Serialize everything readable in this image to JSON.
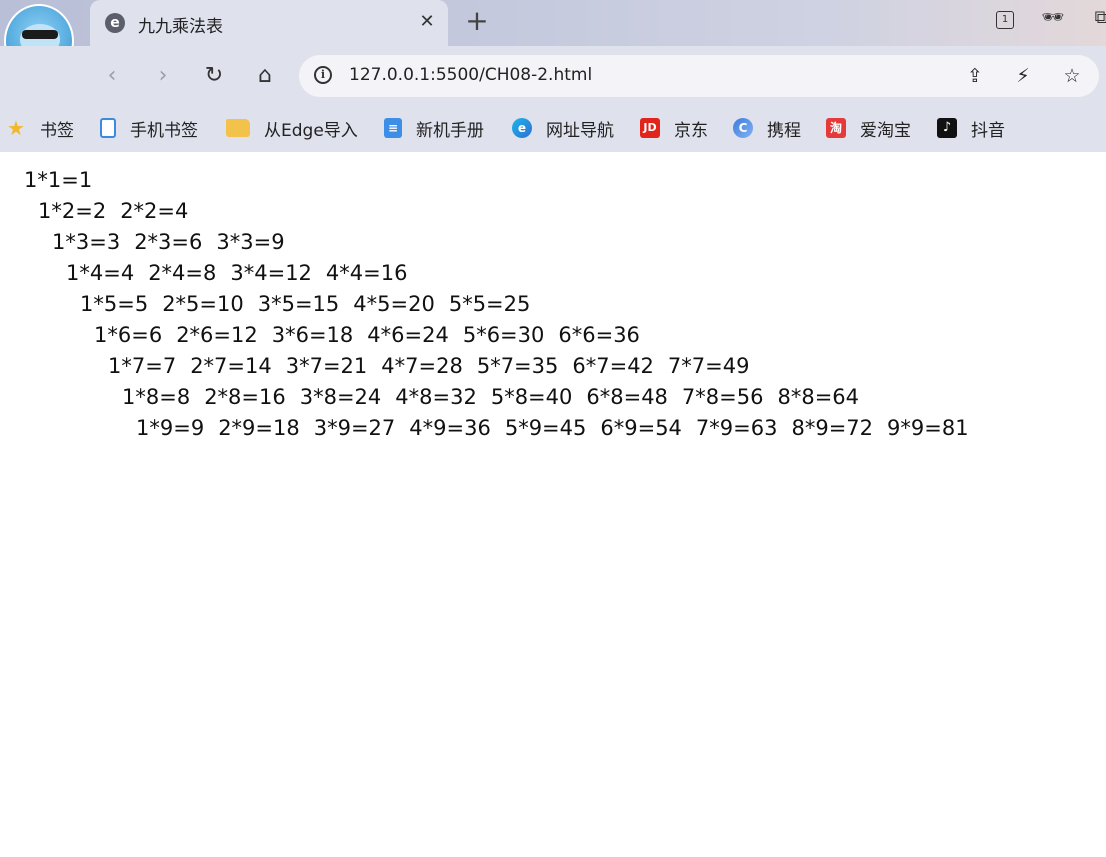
{
  "tab": {
    "title": "九九乘法表"
  },
  "address_bar": {
    "url": "127.0.0.1:5500/CH08-2.html"
  },
  "window_controls": {
    "tab_count": "1"
  },
  "bookmarks": [
    {
      "label": "书签",
      "icon": "star-icon"
    },
    {
      "label": "手机书签",
      "icon": "phone-icon"
    },
    {
      "label": "从Edge导入",
      "icon": "folder-icon"
    },
    {
      "label": "新机手册",
      "icon": "document-icon"
    },
    {
      "label": "网址导航",
      "icon": "edge-icon"
    },
    {
      "label": "京东",
      "icon": "jd-icon"
    },
    {
      "label": "携程",
      "icon": "ctrip-icon"
    },
    {
      "label": "爱淘宝",
      "icon": "taobao-icon"
    },
    {
      "label": "抖音",
      "icon": "douyin-icon"
    }
  ],
  "table": {
    "rows": [
      [
        "1*1=1"
      ],
      [
        "1*2=2",
        "2*2=4"
      ],
      [
        "1*3=3",
        "2*3=6",
        "3*3=9"
      ],
      [
        "1*4=4",
        "2*4=8",
        "3*4=12",
        "4*4=16"
      ],
      [
        "1*5=5",
        "2*5=10",
        "3*5=15",
        "4*5=20",
        "5*5=25"
      ],
      [
        "1*6=6",
        "2*6=12",
        "3*6=18",
        "4*6=24",
        "5*6=30",
        "6*6=36"
      ],
      [
        "1*7=7",
        "2*7=14",
        "3*7=21",
        "4*7=28",
        "5*7=35",
        "6*7=42",
        "7*7=49"
      ],
      [
        "1*8=8",
        "2*8=16",
        "3*8=24",
        "4*8=32",
        "5*8=40",
        "6*8=48",
        "7*8=56",
        "8*8=64"
      ],
      [
        "1*9=9",
        "2*9=18",
        "3*9=27",
        "4*9=36",
        "5*9=45",
        "6*9=54",
        "7*9=63",
        "8*9=72",
        "9*9=81"
      ]
    ]
  }
}
